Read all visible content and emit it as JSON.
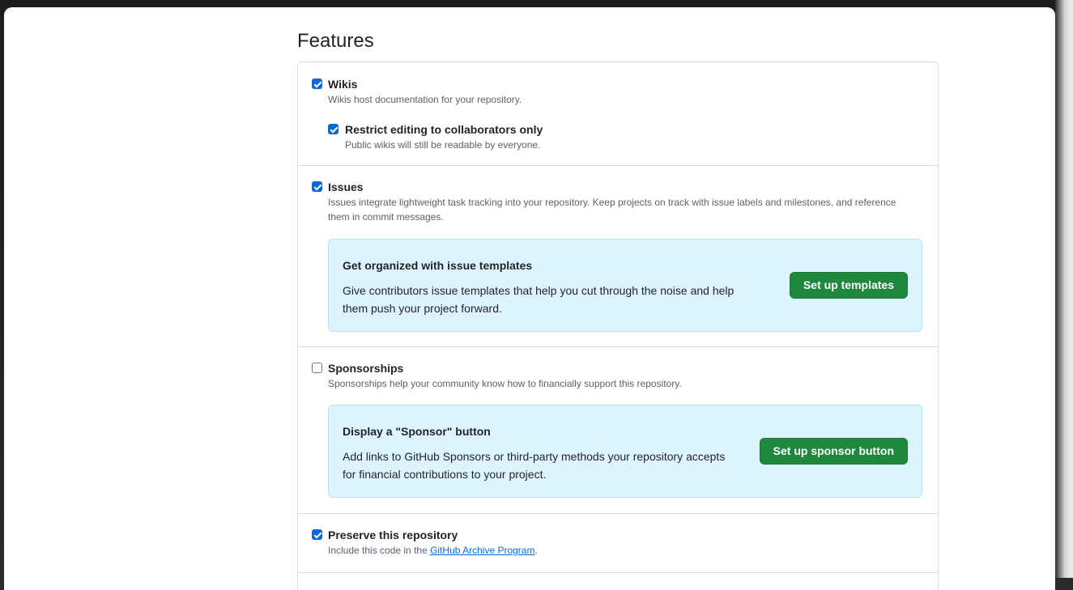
{
  "features": {
    "title": "Features",
    "wikis": {
      "label": "Wikis",
      "description": "Wikis host documentation for your repository.",
      "checked": true,
      "restrict": {
        "label": "Restrict editing to collaborators only",
        "description": "Public wikis will still be readable by everyone.",
        "checked": true
      }
    },
    "issues": {
      "label": "Issues",
      "description": "Issues integrate lightweight task tracking into your repository. Keep projects on track with issue labels and milestones, and reference them in commit messages.",
      "checked": true,
      "callout": {
        "title": "Get organized with issue templates",
        "text": "Give contributors issue templates that help you cut through the noise and help them push your project forward.",
        "button": "Set up templates"
      }
    },
    "sponsorships": {
      "label": "Sponsorships",
      "description": "Sponsorships help your community know how to financially support this repository.",
      "checked": false,
      "callout": {
        "title": "Display a \"Sponsor\" button",
        "text": "Add links to GitHub Sponsors or third-party methods your repository accepts for financial contributions to your project.",
        "button": "Set up sponsor button"
      }
    },
    "preserve": {
      "label": "Preserve this repository",
      "description_prefix": "Include this code in the ",
      "link": "GitHub Archive Program",
      "description_suffix": ".",
      "checked": true
    }
  },
  "colors": {
    "accent": "#0969da",
    "button_green": "#1f883d",
    "callout_bg": "#ddf4ff"
  }
}
